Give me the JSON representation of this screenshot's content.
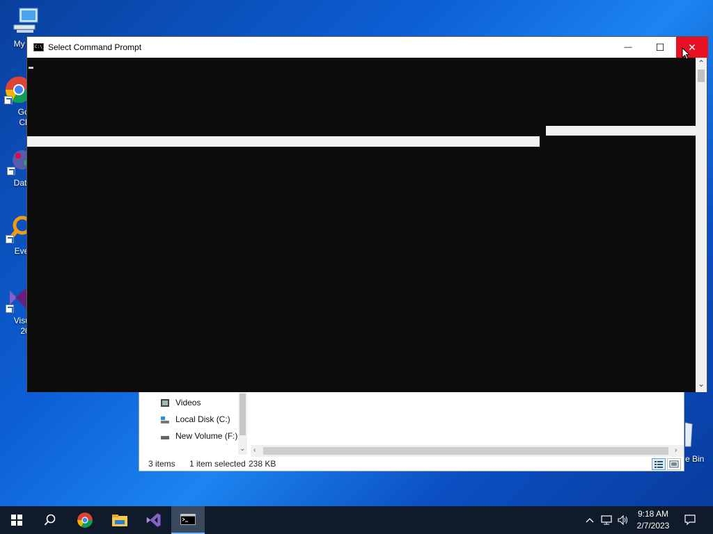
{
  "desktop": {
    "icons": [
      {
        "label": "My Co"
      },
      {
        "label_line1": "Goo",
        "label_line2": "Chr"
      },
      {
        "label": "DataW"
      },
      {
        "label": "Every"
      },
      {
        "label_line1": "Visual",
        "label_line2": "20"
      }
    ],
    "recycle_label": "e Bin"
  },
  "cmd_window": {
    "title": "Select Command Prompt",
    "icon_text": "C:\\_",
    "minimize_glyph": "—",
    "maximize_glyph": "☐",
    "close_glyph": "✕",
    "scroll_up": "⌃",
    "scroll_down": "⌄"
  },
  "explorer": {
    "nav_items": [
      {
        "label": "Videos",
        "icon": "videos-icon"
      },
      {
        "label": "Local Disk (C:)",
        "icon": "drive-icon"
      },
      {
        "label": "New Volume (F:)",
        "icon": "drive-icon"
      }
    ],
    "status": {
      "items": "3 items",
      "selected": "1 item selected",
      "size": "238 KB"
    }
  },
  "taskbar": {
    "clock_time": "9:18 AM",
    "clock_date": "2/7/2023",
    "pinned": [
      "start-icon",
      "search-icon",
      "chrome-icon",
      "file-explorer-icon",
      "visual-studio-icon",
      "command-prompt-icon"
    ]
  },
  "colors": {
    "close_red": "#e81123",
    "console_bg": "#0c0c0c",
    "taskbar_bg": "#0f1a2a"
  }
}
